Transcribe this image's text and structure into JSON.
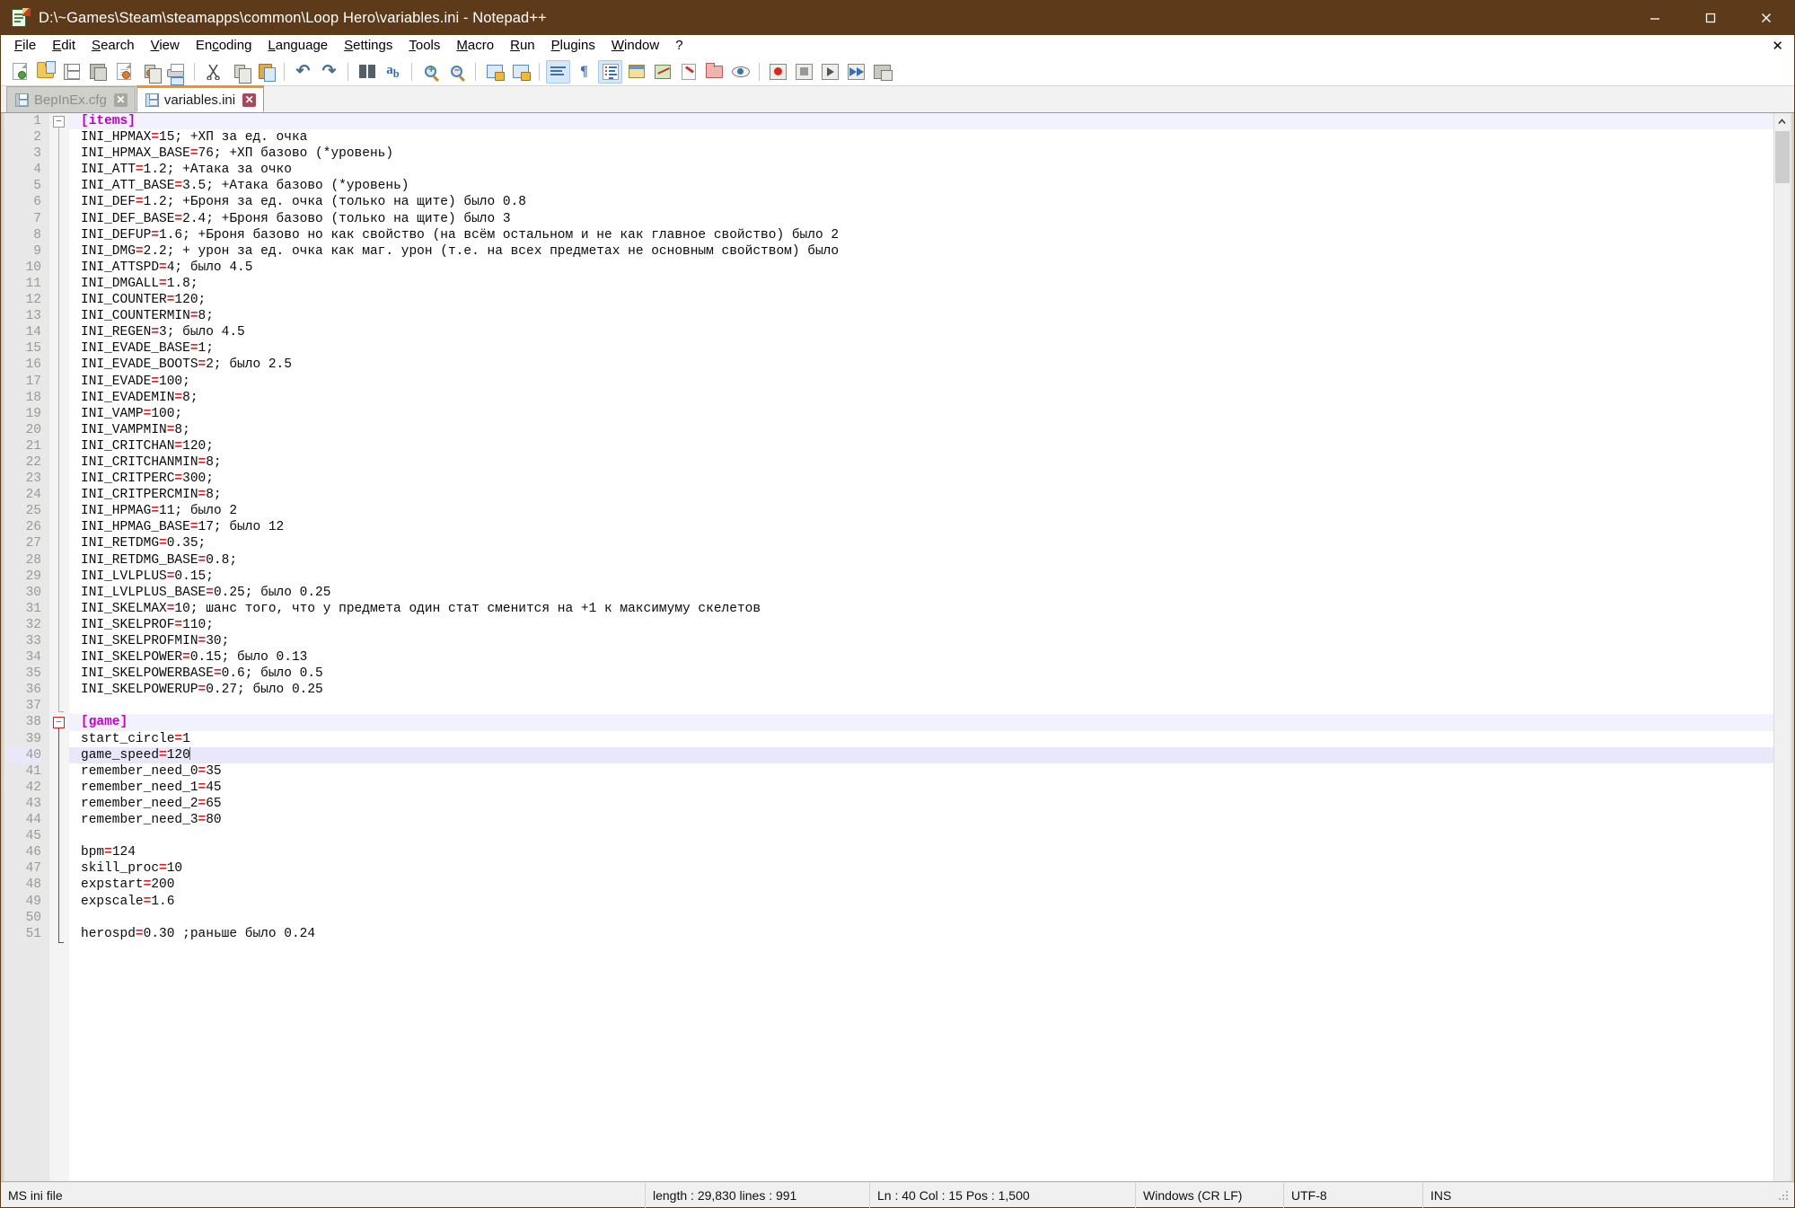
{
  "window": {
    "title": "D:\\~Games\\Steam\\steamapps\\common\\Loop Hero\\variables.ini - Notepad++",
    "icon": "notepad-plus-plus-icon",
    "minimize_label": "–",
    "maximize_label": "□",
    "close_label": "✕",
    "titlebar_color": "#5d3a19"
  },
  "menubar": {
    "items": [
      {
        "label": "File",
        "accel": "F"
      },
      {
        "label": "Edit",
        "accel": "E"
      },
      {
        "label": "Search",
        "accel": "S"
      },
      {
        "label": "View",
        "accel": "V"
      },
      {
        "label": "Encoding",
        "accel": "c"
      },
      {
        "label": "Language",
        "accel": "L"
      },
      {
        "label": "Settings",
        "accel": "S"
      },
      {
        "label": "Tools",
        "accel": "T"
      },
      {
        "label": "Macro",
        "accel": "M"
      },
      {
        "label": "Run",
        "accel": "R"
      },
      {
        "label": "Plugins",
        "accel": "P"
      },
      {
        "label": "Window",
        "accel": "W"
      },
      {
        "label": "?",
        "accel": ""
      }
    ],
    "close_document_label": "✕"
  },
  "toolbar": {
    "icons": [
      "new-file-icon",
      "open-file-icon",
      "save-icon",
      "save-all-icon",
      "close-file-icon",
      "close-all-files-icon",
      "print-icon",
      "sep",
      "cut-icon",
      "copy-icon",
      "paste-icon",
      "sep",
      "undo-icon",
      "redo-icon",
      "sep",
      "find-icon",
      "replace-icon",
      "sep",
      "zoom-in-icon",
      "zoom-out-icon",
      "sep",
      "sync-vertical-scrolling-icon",
      "sync-horizontal-scrolling-icon",
      "sep",
      "word-wrap-icon",
      "show-all-characters-icon",
      "indent-guide-icon",
      "user-defined-dialog-icon",
      "document-map-icon",
      "function-list-icon",
      "folder-as-workspace-icon",
      "monitoring-icon",
      "sep",
      "record-macro-icon",
      "stop-recording-icon",
      "play-macro-icon",
      "run-macro-multiple-icon",
      "run-panel-icon"
    ],
    "active_toggles": [
      "word-wrap-icon",
      "indent-guide-icon"
    ]
  },
  "tabs": [
    {
      "label": "BepInEx.cfg",
      "active": false,
      "icon": "saved-file-icon",
      "close_label": "✕"
    },
    {
      "label": "variables.ini",
      "active": true,
      "icon": "saved-file-icon",
      "close_label": "✕"
    }
  ],
  "editor": {
    "current_line": 40,
    "first_line": 1,
    "lines": [
      {
        "n": 1,
        "text": "[items]",
        "type": "section",
        "fold": "open"
      },
      {
        "n": 2,
        "text": "INI_HPMAX=15; +ХП за ед. очка"
      },
      {
        "n": 3,
        "text": "INI_HPMAX_BASE=76; +ХП базово (*уровень)"
      },
      {
        "n": 4,
        "text": "INI_ATT=1.2; +Атака за очко"
      },
      {
        "n": 5,
        "text": "INI_ATT_BASE=3.5; +Атака базово (*уровень)"
      },
      {
        "n": 6,
        "text": "INI_DEF=1.2; +Броня за ед. очка (только на щите) было 0.8"
      },
      {
        "n": 7,
        "text": "INI_DEF_BASE=2.4; +Броня базово (только на щите) было 3"
      },
      {
        "n": 8,
        "text": "INI_DEFUP=1.6; +Броня базово но как свойство (на всём остальном и не как главное свойство) было 2"
      },
      {
        "n": 9,
        "text": "INI_DMG=2.2; + урон за ед. очка как маг. урон (т.е. на всех предметах не основным свойством) было"
      },
      {
        "n": 10,
        "text": "INI_ATTSPD=4; было 4.5"
      },
      {
        "n": 11,
        "text": "INI_DMGALL=1.8;"
      },
      {
        "n": 12,
        "text": "INI_COUNTER=120;"
      },
      {
        "n": 13,
        "text": "INI_COUNTERMIN=8;"
      },
      {
        "n": 14,
        "text": "INI_REGEN=3; было 4.5"
      },
      {
        "n": 15,
        "text": "INI_EVADE_BASE=1;"
      },
      {
        "n": 16,
        "text": "INI_EVADE_BOOTS=2; было 2.5"
      },
      {
        "n": 17,
        "text": "INI_EVADE=100;"
      },
      {
        "n": 18,
        "text": "INI_EVADEMIN=8;"
      },
      {
        "n": 19,
        "text": "INI_VAMP=100;"
      },
      {
        "n": 20,
        "text": "INI_VAMPMIN=8;"
      },
      {
        "n": 21,
        "text": "INI_CRITCHAN=120;"
      },
      {
        "n": 22,
        "text": "INI_CRITCHANMIN=8;"
      },
      {
        "n": 23,
        "text": "INI_CRITPERC=300;"
      },
      {
        "n": 24,
        "text": "INI_CRITPERCMIN=8;"
      },
      {
        "n": 25,
        "text": "INI_HPMAG=11; было 2"
      },
      {
        "n": 26,
        "text": "INI_HPMAG_BASE=17; было 12"
      },
      {
        "n": 27,
        "text": "INI_RETDMG=0.35;"
      },
      {
        "n": 28,
        "text": "INI_RETDMG_BASE=0.8;"
      },
      {
        "n": 29,
        "text": "INI_LVLPLUS=0.15;"
      },
      {
        "n": 30,
        "text": "INI_LVLPLUS_BASE=0.25; было 0.25"
      },
      {
        "n": 31,
        "text": "INI_SKELMAX=10; шанс того, что у предмета один стат сменится на +1 к максимуму скелетов"
      },
      {
        "n": 32,
        "text": "INI_SKELPROF=110;"
      },
      {
        "n": 33,
        "text": "INI_SKELPROFMIN=30;"
      },
      {
        "n": 34,
        "text": "INI_SKELPOWER=0.15; было 0.13"
      },
      {
        "n": 35,
        "text": "INI_SKELPOWERBASE=0.6; было 0.5"
      },
      {
        "n": 36,
        "text": "INI_SKELPOWERUP=0.27; было 0.25"
      },
      {
        "n": 37,
        "text": ""
      },
      {
        "n": 38,
        "text": "[game]",
        "type": "section",
        "fold": "open-active"
      },
      {
        "n": 39,
        "text": "start_circle=1"
      },
      {
        "n": 40,
        "text": "game_speed=120",
        "caret_at_end": true
      },
      {
        "n": 41,
        "text": "remember_need_0=35"
      },
      {
        "n": 42,
        "text": "remember_need_1=45"
      },
      {
        "n": 43,
        "text": "remember_need_2=65"
      },
      {
        "n": 44,
        "text": "remember_need_3=80"
      },
      {
        "n": 45,
        "text": ""
      },
      {
        "n": 46,
        "text": "bpm=124"
      },
      {
        "n": 47,
        "text": "skill_proc=10"
      },
      {
        "n": 48,
        "text": "expstart=200"
      },
      {
        "n": 49,
        "text": "expscale=1.6"
      },
      {
        "n": 50,
        "text": ""
      },
      {
        "n": 51,
        "text": "herospd=0.30 ;раньше было 0.24"
      }
    ],
    "scrollbar": {
      "up_arrow": "▲",
      "down_arrow": "▼"
    }
  },
  "statusbar": {
    "file_type": "MS ini file",
    "length_lines": "length : 29,830   lines : 991",
    "position": "Ln : 40   Col : 15   Pos : 1,500",
    "eol": "Windows (CR LF)",
    "encoding": "UTF-8",
    "insert_mode": "INS"
  }
}
